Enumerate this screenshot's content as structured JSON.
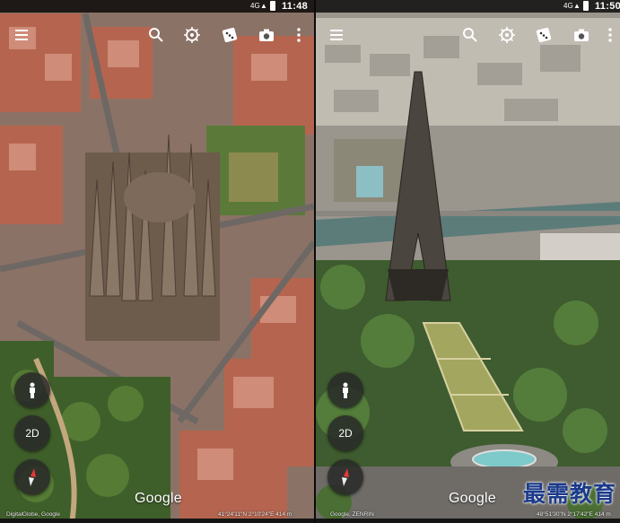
{
  "left": {
    "status": {
      "signal": "4G",
      "time": "11:48"
    },
    "toolbar": [
      "menu-icon",
      "search-icon",
      "voyager-icon",
      "random-dice-icon",
      "camera-icon",
      "more-vert-icon"
    ],
    "buttons": {
      "person": "person-icon",
      "view_mode": "2D",
      "compass": "compass-icon"
    },
    "logo": "Google",
    "attribution": "DigitalGlobe, Google",
    "coordinates": "41°24'11\"N 2°10'24\"E 414 m"
  },
  "right": {
    "status": {
      "signal": "4G",
      "time": "11:50"
    },
    "toolbar": [
      "menu-icon",
      "search-icon",
      "voyager-icon",
      "random-dice-icon",
      "camera-icon",
      "more-vert-icon"
    ],
    "buttons": {
      "person": "person-icon",
      "view_mode": "2D",
      "compass": "compass-icon"
    },
    "logo": "Google",
    "attribution": "Google, ZENRIN",
    "coordinates": "48°51'30\"N 2°17'42\"E 414 m"
  },
  "watermark": "最需教育",
  "colors": {
    "roof": "#c76a55",
    "park": "#4c6e33",
    "river": "#5f7c7a",
    "fab": "#2a2a2a"
  }
}
